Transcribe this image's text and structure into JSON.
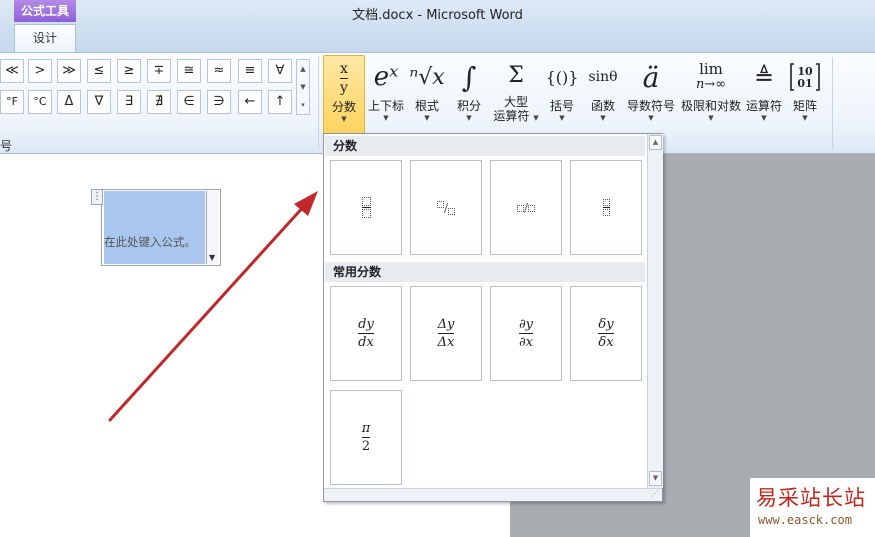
{
  "window": {
    "title": "文档.docx - Microsoft Word",
    "context_tab_group": "公式工具",
    "active_tab": "设计"
  },
  "ribbon": {
    "symbols_row1": [
      "≪",
      ">",
      "≫",
      "≤",
      "≥",
      "∓",
      "≅",
      "≈",
      "≡",
      "∀"
    ],
    "symbols_row2": [
      "°F",
      "°C",
      "Δ",
      "∇",
      "∃",
      "∄",
      "∈",
      "∋",
      "←",
      "↑"
    ],
    "symbols_group_label": "号",
    "tools": [
      {
        "id": "fraction",
        "glyph_top": "x",
        "glyph_bottom": "y",
        "label": "分数",
        "active": true
      },
      {
        "id": "script",
        "glyph": "eˣ",
        "label": "上下标"
      },
      {
        "id": "radical",
        "glyph": "ⁿ√x",
        "label": "根式"
      },
      {
        "id": "integral",
        "glyph": "∫",
        "label": "积分"
      },
      {
        "id": "large-operator",
        "glyph": "Σ",
        "label": "大型",
        "label2": "运算符"
      },
      {
        "id": "bracket",
        "glyph": "{()}",
        "label": "括号"
      },
      {
        "id": "function",
        "glyph": "sinθ",
        "label": "函数"
      },
      {
        "id": "accent",
        "glyph": "ä",
        "label": "导数符号"
      },
      {
        "id": "limit-log",
        "glyph": "lim",
        "glyph_sub": "n→∞",
        "label": "极限和对数"
      },
      {
        "id": "operator",
        "glyph": "≜",
        "label": "运算符"
      },
      {
        "id": "matrix",
        "glyph": "[10 01]",
        "label": "矩阵"
      }
    ]
  },
  "document": {
    "equation_placeholder": "在此处键入公式。"
  },
  "gallery": {
    "section1_title": "分数",
    "section2_title": "常用分数",
    "common": [
      {
        "num": "dy",
        "den": "dx"
      },
      {
        "num": "Δy",
        "den": "Δx"
      },
      {
        "num": "∂y",
        "den": "∂x"
      },
      {
        "num": "δy",
        "den": "δx"
      },
      {
        "num": "π",
        "den": "2"
      }
    ]
  },
  "watermark": {
    "cn": "易采站长站",
    "url": "www.easck.com"
  },
  "colors": {
    "arrow": "#c0282a",
    "active_tool": "#ffd35c",
    "context_tab": "#8f5ed8"
  }
}
